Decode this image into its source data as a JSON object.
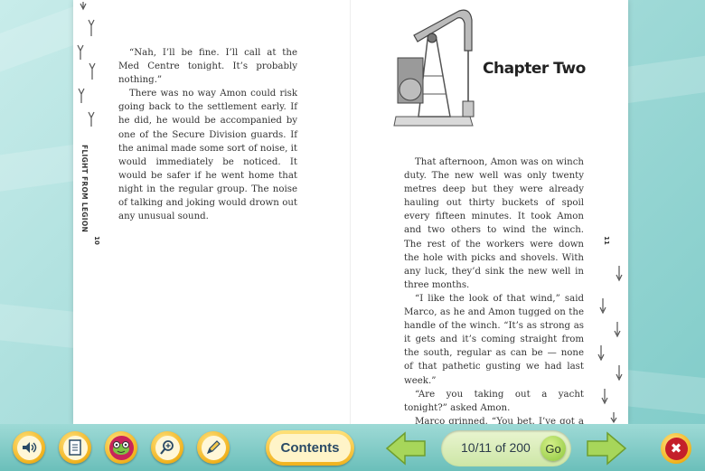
{
  "book": {
    "running_title": "FLIGHT FROM LEGION",
    "left_page_number": "10",
    "right_page_number": "11",
    "chapter_title": "Chapter Two",
    "left_paragraphs": [
      "“Nah, I’ll be fine. I’ll call at the Med Centre tonight. It’s probably nothing.”",
      "There was no way Amon could risk going back to the settlement early. If he did, he would be accompanied by one of the Secure Division guards. If the animal made some sort of noise, it would immediately be noticed. It would be safer if he went home that night in the regular group. The noise of talking and joking would drown out any unusual sound."
    ],
    "right_paragraphs": [
      "That afternoon, Amon was on winch duty. The new well was only twenty metres deep but they were already hauling out thirty buckets of spoil every fifteen minutes. It took Amon and two others to wind the winch. The rest of the workers were down the hole with picks and shovels. With any luck, they’d sink the new well in three months.",
      "“I like the look of that wind,” said Marco, as he and Amon tugged on the handle of the winch. “It’s as strong as it gets and it’s coming straight from the south, regular as can be — none of that pathetic gusting we had last week.”",
      "“Are you taking out a yacht tonight?” asked Amon.",
      "Marco grinned. “You bet. I’ve got a time trial in two weeks and I’m aiming to cut the record by three seconds.”"
    ]
  },
  "toolbar": {
    "tools": [
      {
        "icon": "speaker-icon"
      },
      {
        "icon": "document-list-icon"
      },
      {
        "icon": "frog-icon"
      },
      {
        "icon": "zoom-in-icon"
      },
      {
        "icon": "pencil-icon"
      }
    ],
    "contents_label": "Contents",
    "page_indicator": "10/11 of 200",
    "go_label": "Go",
    "close_symbol": "✖"
  },
  "colors": {
    "accent": "#f1b21d",
    "nav_arrow": "#a7d65a",
    "close": "#c41f2a",
    "background": "#a9dedc"
  }
}
